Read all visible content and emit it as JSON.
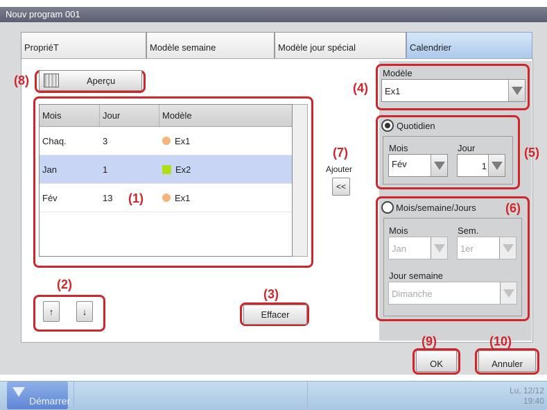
{
  "window": {
    "title": "Nouv program 001"
  },
  "tabs": [
    {
      "label": "PropriéT"
    },
    {
      "label": "Modèle semaine"
    },
    {
      "label": "Modèle jour spécial"
    },
    {
      "label": "Calendrier"
    }
  ],
  "preview_button": {
    "label": "Aperçu"
  },
  "table": {
    "headers": [
      "Mois",
      "Jour",
      "Modèle"
    ],
    "rows": [
      {
        "month": "Chaq.",
        "day": "3",
        "model": "Ex1",
        "marker": "circle",
        "marker_color": "#f4b57b"
      },
      {
        "month": "Jan",
        "day": "1",
        "model": "Ex2",
        "marker": "square",
        "marker_color": "#b2dd1a",
        "selected": true
      },
      {
        "month": "Fév",
        "day": "13",
        "model": "Ex1",
        "marker": "circle",
        "marker_color": "#f4b57b"
      }
    ]
  },
  "add": {
    "label": "Ajouter",
    "button": "<<"
  },
  "move": {
    "up": "↑",
    "down": "↓"
  },
  "delete_button": {
    "label": "Effacer"
  },
  "model_select": {
    "label": "Modèle",
    "value": "Ex1"
  },
  "daily": {
    "label": "Quotidien",
    "selected": true,
    "month_label": "Mois",
    "month_value": "Fév",
    "day_label": "Jour",
    "day_value": "1"
  },
  "weekly": {
    "label": "Mois/semaine/Jours",
    "selected": false,
    "month_label": "Mois",
    "month_value": "Jan",
    "week_label": "Sem.",
    "week_value": "1er",
    "weekday_label": "Jour semaine",
    "weekday_value": "Dimanche"
  },
  "footer": {
    "ok": "OK",
    "cancel": "Annuler"
  },
  "callouts": {
    "c1": "(1)",
    "c2": "(2)",
    "c3": "(3)",
    "c4": "(4)",
    "c5": "(5)",
    "c6": "(6)",
    "c7": "(7)",
    "c8": "(8)",
    "c9": "(9)",
    "c10": "(10)"
  },
  "taskbar": {
    "start_label": "Démarrer",
    "clock_date": "Lu, 12/12",
    "clock_time": "19:40"
  },
  "colors": {
    "callout": "#d0252a",
    "selected_row": "#c8d5f5",
    "active_tab": "#a9c7ea"
  }
}
